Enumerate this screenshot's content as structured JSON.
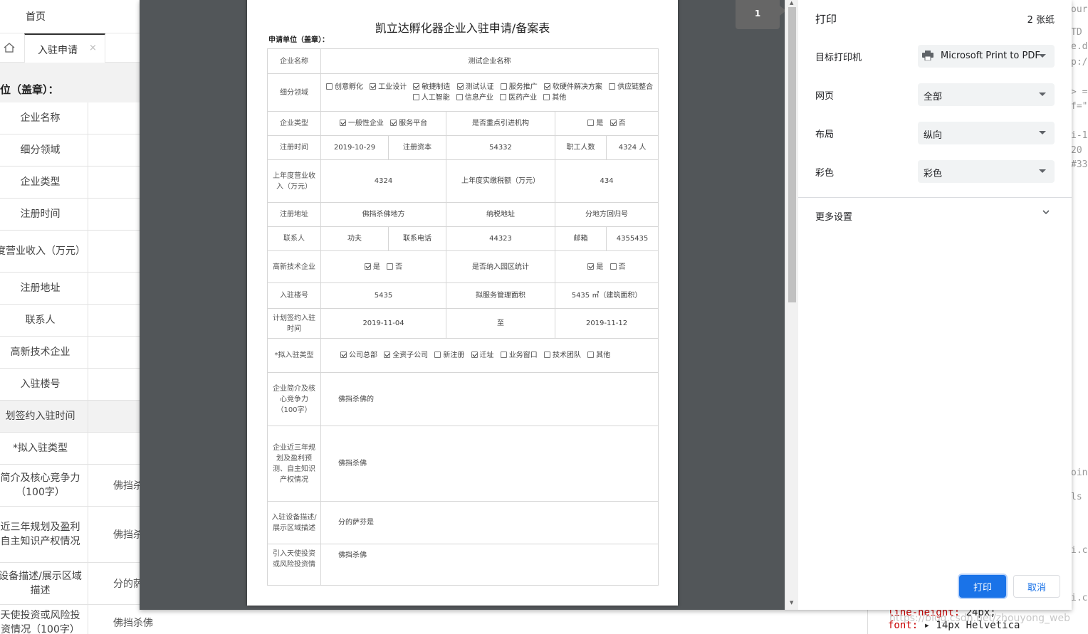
{
  "background": {
    "home": "首页",
    "tab": "入驻申请",
    "tab_close": "×",
    "unit": "位（盖章）：",
    "rows": [
      {
        "label": "企业名称",
        "value": ""
      },
      {
        "label": "细分领域",
        "value": ""
      },
      {
        "label": "企业类型",
        "value": ""
      },
      {
        "label": "注册时间",
        "value": ""
      },
      {
        "label": "度营业收入（万元）",
        "value": ""
      },
      {
        "label": "注册地址",
        "value": ""
      },
      {
        "label": "联系人",
        "value": ""
      },
      {
        "label": "高新技术企业",
        "value": ""
      },
      {
        "label": "入驻楼号",
        "value": ""
      },
      {
        "label": "划签约入驻时间",
        "value": ""
      },
      {
        "label": "*拟入驻类型",
        "value": ""
      },
      {
        "label": "简介及核心竞争力（100字）",
        "value": "佛挡杀"
      },
      {
        "label": "近三年规划及盈利自主知识产权情况",
        "value": "佛挡杀"
      },
      {
        "label": "设备描述/展示区域描述",
        "value": "分的萨"
      },
      {
        "label": "天使投资或风险投资情况（100字）",
        "value": "佛挡杀佛"
      }
    ],
    "code_right": [
      "ourc",
      "TD h",
      "e.dt",
      "p:/",
      "> =",
      "f=\"",
      "i-1",
      "20",
      "#33",
      "oint",
      "ls",
      "i.c",
      "i.c"
    ],
    "code_bottom": {
      "prop1": "line-height",
      "val1": "24px;",
      "prop2": "font",
      "val2": "▸ 14px Helvetica",
      "watermark": "https://blog.csdn.net/zhouyong_web"
    }
  },
  "preview": {
    "page_number": "1",
    "title": "凯立达孵化器企业入驻申请/备案表",
    "unit_label": "申请单位（盖章）：",
    "company_label": "企业名称",
    "company_value": "测试企业名称",
    "field_label": "细分领域",
    "fields": [
      {
        "t": "创意孵化",
        "c": false
      },
      {
        "t": "工业设计",
        "c": true
      },
      {
        "t": "敏捷制造",
        "c": true
      },
      {
        "t": "测试认证",
        "c": true
      },
      {
        "t": "服务推广",
        "c": false
      },
      {
        "t": "软硬件解决方案",
        "c": true
      },
      {
        "t": "供应链整合",
        "c": false
      },
      {
        "t": "人工智能",
        "c": false
      },
      {
        "t": "信息产业",
        "c": false
      },
      {
        "t": "医药产业",
        "c": false
      },
      {
        "t": "其他",
        "c": false
      }
    ],
    "type_label": "企业类型",
    "types": [
      {
        "t": "一般性企业",
        "c": true
      },
      {
        "t": "服务平台",
        "c": true
      }
    ],
    "key_label": "是否重点引进机构",
    "key_opts": [
      {
        "t": "是",
        "c": false
      },
      {
        "t": "否",
        "c": true
      }
    ],
    "reg_time_label": "注册时间",
    "reg_time": "2019-10-29",
    "capital_label": "注册资本",
    "capital": "54332",
    "staff_label": "职工人数",
    "staff": "4324 人",
    "revenue_label": "上年度营业收入（万元）",
    "revenue": "4324",
    "tax_label": "上年度实缴税额（万元）",
    "tax": "434",
    "address_label": "注册地址",
    "address": "佛挡杀佛地方",
    "tax_address_label": "纳税地址",
    "tax_address": "分地方回归号",
    "contact_label": "联系人",
    "contact": "功夫",
    "phone_label": "联系电话",
    "phone": "44323",
    "email_label": "邮箱",
    "email": "4355435",
    "hitech_label": "高新技术企业",
    "hitech_opts": [
      {
        "t": "是",
        "c": true
      },
      {
        "t": "否",
        "c": false
      }
    ],
    "stat_label": "是否纳入园区统计",
    "stat_opts": [
      {
        "t": "是",
        "c": true
      },
      {
        "t": "否",
        "c": false
      }
    ],
    "building_label": "入驻楼号",
    "building": "5435",
    "area_label": "拟服务管理面积",
    "area": "5435 ㎡（建筑面积）",
    "plan_label": "计划签约入驻时间",
    "plan_start": "2019-11-04",
    "plan_to": "至",
    "plan_end": "2019-11-12",
    "settle_label": "*拟入驻类型",
    "settle_opts": [
      {
        "t": "公司总部",
        "c": true
      },
      {
        "t": "全资子公司",
        "c": true
      },
      {
        "t": "新注册",
        "c": false
      },
      {
        "t": "迁址",
        "c": true
      },
      {
        "t": "业务窗口",
        "c": false
      },
      {
        "t": "技术团队",
        "c": false
      },
      {
        "t": "其他",
        "c": false
      }
    ],
    "intro_label": "企业简介及核心竞争力（100字）",
    "intro": "佛挡杀佛的",
    "plan3_label": "企业近三年规划及盈利预测、自主知识产权情况",
    "plan3": "佛挡杀佛",
    "equip_label": "入驻设备描述/展示区域描述",
    "equip": "分的萨芬是",
    "invest_label": "引入天使投资或风险投资情",
    "invest": "佛挡杀佛"
  },
  "settings": {
    "title": "打印",
    "sheets": "2 张纸",
    "dest_label": "目标打印机",
    "dest_value": "Microsoft Print to PDF",
    "pages_label": "网页",
    "pages_value": "全部",
    "layout_label": "布局",
    "layout_value": "纵向",
    "color_label": "彩色",
    "color_value": "彩色",
    "more_label": "更多设置",
    "print_button": "打印",
    "cancel_button": "取消"
  }
}
